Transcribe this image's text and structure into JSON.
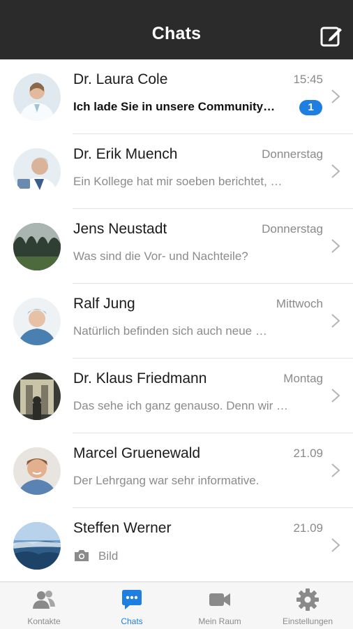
{
  "header": {
    "title": "Chats",
    "compose_icon": "compose-icon"
  },
  "chats": [
    {
      "name": "Dr. Laura Cole",
      "time": "15:45",
      "preview": "Ich lade Sie in unsere Community…",
      "unread": "1",
      "bold": true
    },
    {
      "name": "Dr. Erik Muench",
      "time": "Donnerstag",
      "preview": "Ein Kollege hat mir soeben berichtet, …"
    },
    {
      "name": "Jens Neustadt",
      "time": "Donnerstag",
      "preview": "Was sind die Vor- und Nachteile?"
    },
    {
      "name": "Ralf Jung",
      "time": "Mittwoch",
      "preview": "Natürlich befinden sich auch neue …"
    },
    {
      "name": "Dr. Klaus Friedmann",
      "time": "Montag",
      "preview": "Das sehe ich ganz genauso. Denn wir …"
    },
    {
      "name": "Marcel Gruenewald",
      "time": "21.09",
      "preview": "Der Lehrgang war sehr informative."
    },
    {
      "name": "Steffen Werner",
      "time": "21.09",
      "preview": "Bild",
      "preview_icon": "camera-icon"
    }
  ],
  "tabs": [
    {
      "label": "Kontakte",
      "icon": "contacts-icon"
    },
    {
      "label": "Chats",
      "icon": "chat-bubble-icon",
      "active": true
    },
    {
      "label": "Mein Raum",
      "icon": "video-camera-icon"
    },
    {
      "label": "Einstellungen",
      "icon": "gear-icon"
    }
  ],
  "colors": {
    "header_bg": "#2b2b2b",
    "accent": "#1f7fe0",
    "secondary_text": "#8b8b8b"
  }
}
